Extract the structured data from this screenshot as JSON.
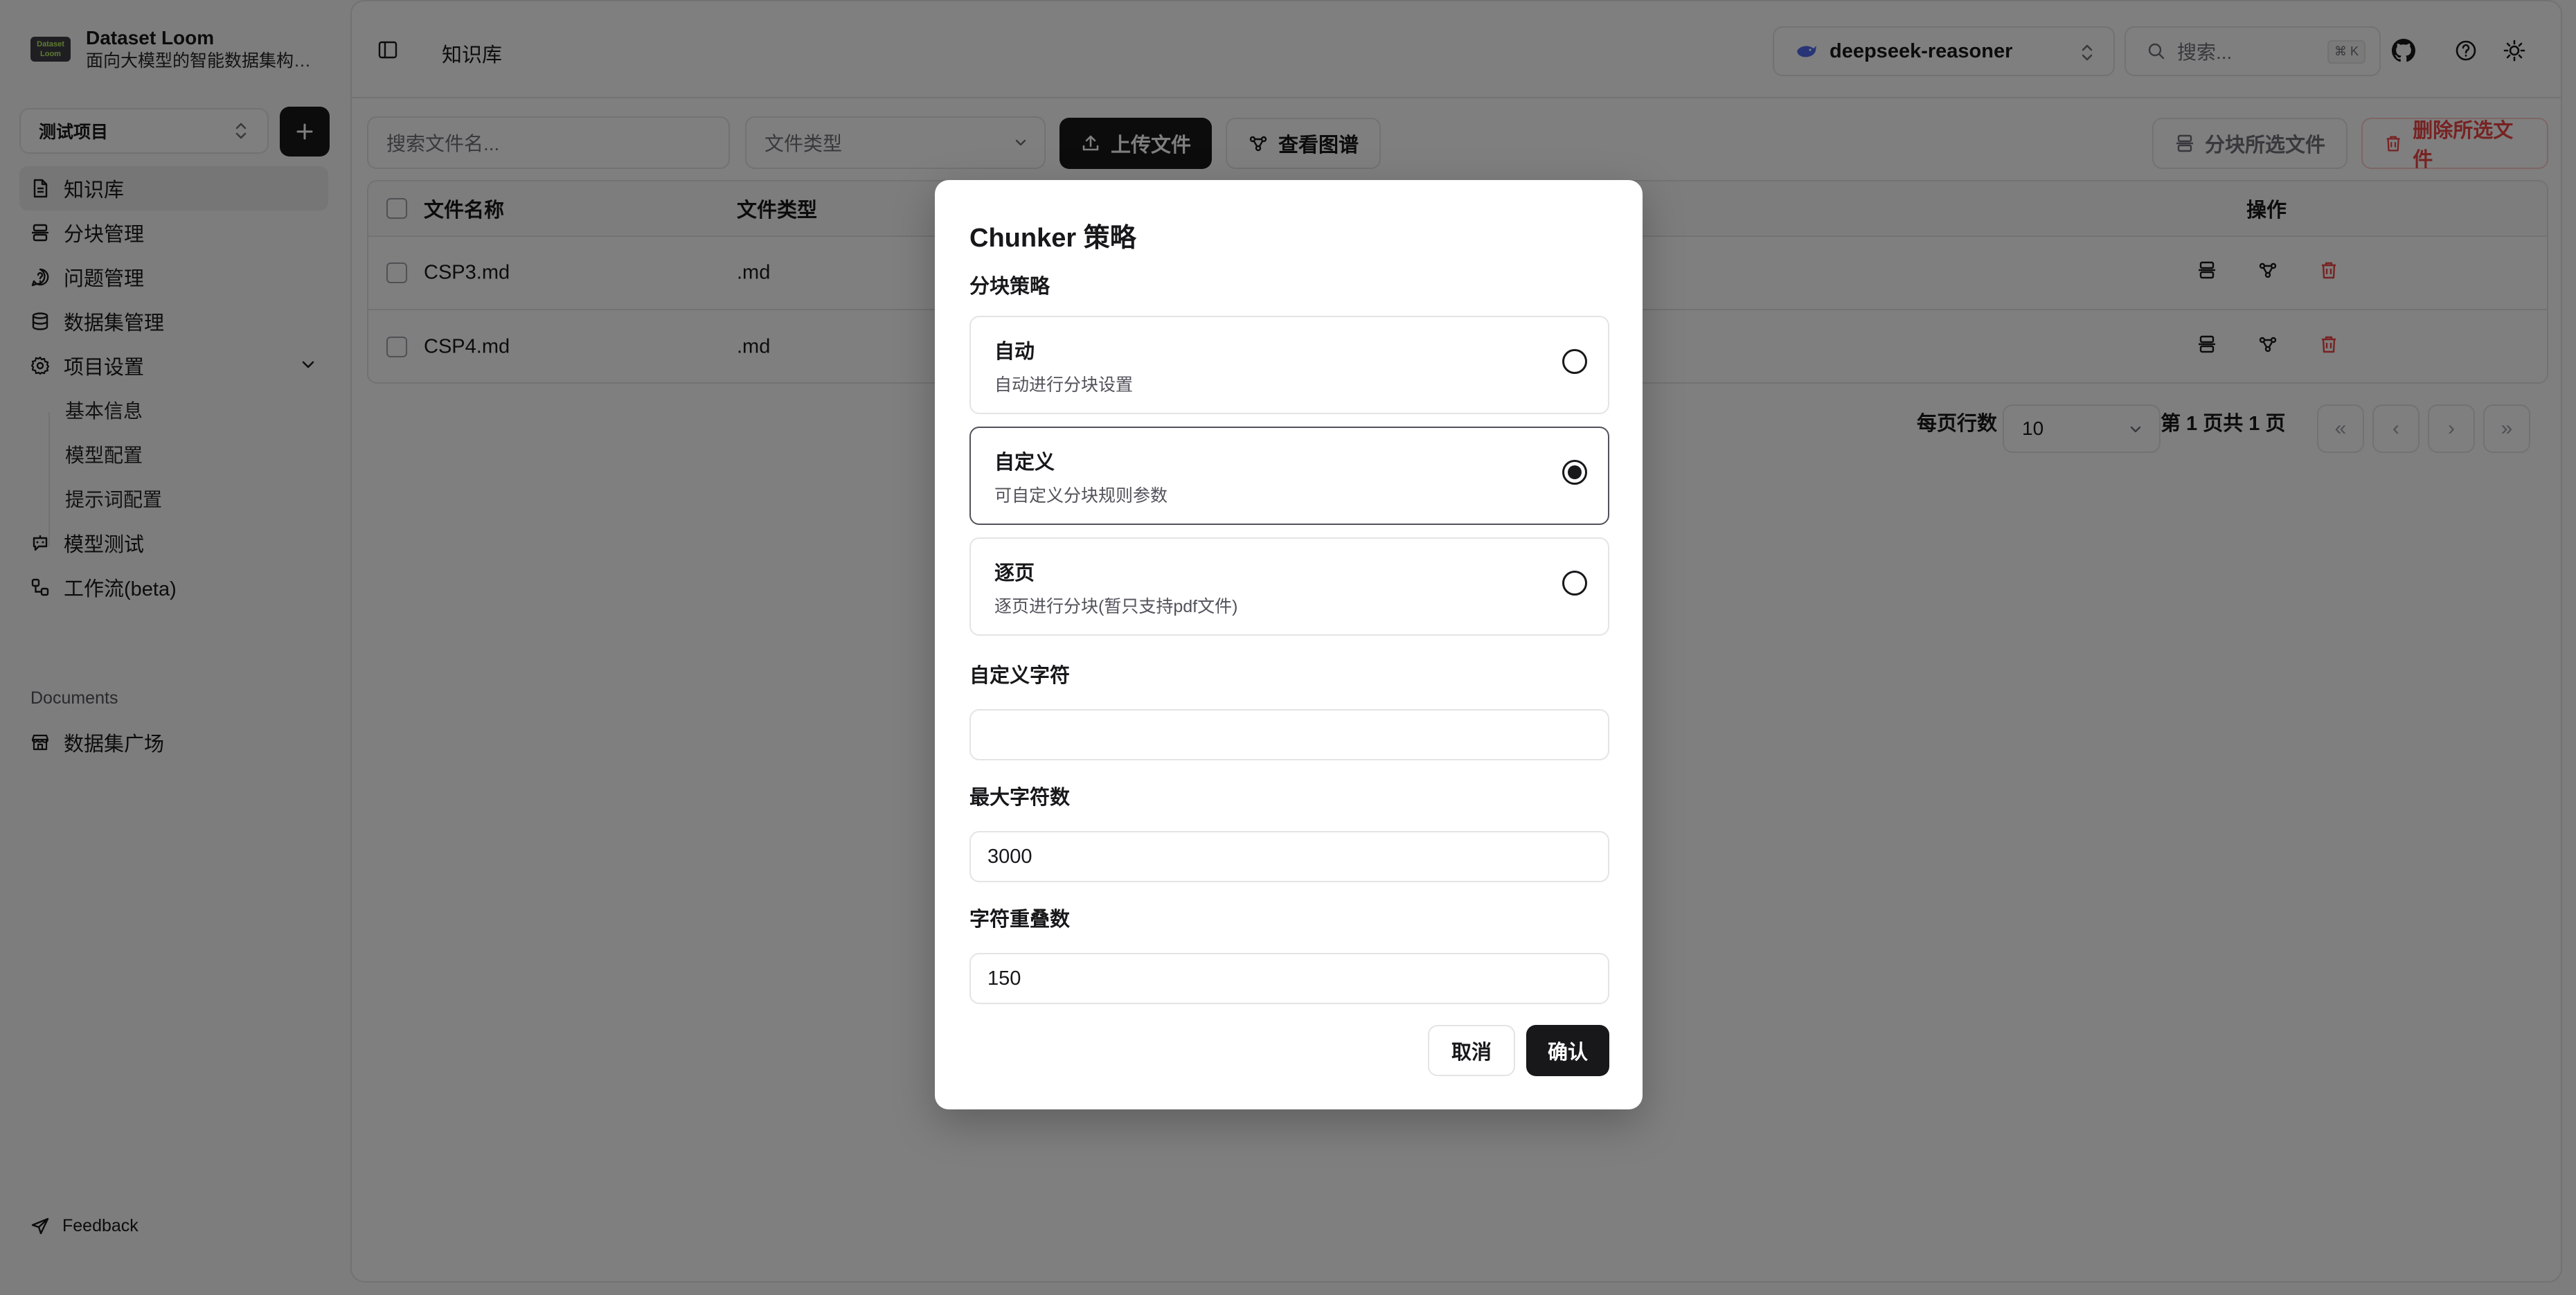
{
  "brand": {
    "name": "Dataset Loom",
    "subtitle": "面向大模型的智能数据集构建...",
    "logo_text_1": "Dataset",
    "logo_text_2": "Loom"
  },
  "project": {
    "selected": "测试项目"
  },
  "nav": {
    "items": [
      {
        "label": "知识库",
        "icon": "file-text-icon",
        "active": true
      },
      {
        "label": "分块管理",
        "icon": "split-icon"
      },
      {
        "label": "问题管理",
        "icon": "message-question-icon"
      },
      {
        "label": "数据集管理",
        "icon": "database-icon"
      },
      {
        "label": "项目设置",
        "icon": "gear-icon"
      }
    ],
    "settings_sub": [
      "基本信息",
      "模型配置",
      "提示词配置"
    ],
    "items_after": [
      {
        "label": "模型测试",
        "icon": "bot-icon"
      },
      {
        "label": "工作流(beta)",
        "icon": "workflow-icon"
      }
    ],
    "documents_label": "Documents",
    "documents_items": [
      {
        "label": "数据集广场",
        "icon": "store-icon"
      }
    ],
    "feedback": "Feedback"
  },
  "topbar": {
    "title": "知识库",
    "model": "deepseek-reasoner",
    "search_placeholder": "搜索...",
    "search_shortcut": "⌘ K"
  },
  "toolbar": {
    "filename_placeholder": "搜索文件名...",
    "filetype_placeholder": "文件类型",
    "upload_label": "上传文件",
    "graph_label": "查看图谱",
    "chunk_selected_label": "分块所选文件",
    "delete_selected_label": "删除所选文件"
  },
  "table": {
    "headers": {
      "name": "文件名称",
      "type": "文件类型",
      "actions": "操作"
    },
    "rows": [
      {
        "name": "CSP3.md",
        "type": ".md"
      },
      {
        "name": "CSP4.md",
        "type": ".md"
      }
    ]
  },
  "pagination": {
    "rows_label": "每页行数",
    "rows_value": "10",
    "page_info": "第 1 页共 1 页"
  },
  "dialog": {
    "title": "Chunker 策略",
    "strategy_label": "分块策略",
    "options": [
      {
        "title": "自动",
        "desc": "自动进行分块设置",
        "selected": false
      },
      {
        "title": "自定义",
        "desc": "可自定义分块规则参数",
        "selected": true
      },
      {
        "title": "逐页",
        "desc": "逐页进行分块(暂只支持pdf文件)",
        "selected": false
      }
    ],
    "custom_chars_label": "自定义字符",
    "custom_chars_value": "",
    "max_chars_label": "最大字符数",
    "max_chars_value": "3000",
    "overlap_label": "字符重叠数",
    "overlap_value": "150",
    "cancel_label": "取消",
    "confirm_label": "确认"
  },
  "colors": {
    "primary": "#18181b",
    "danger": "#ef4444",
    "border": "#e4e4e7",
    "overlay": "rgba(0,0,0,0.5)"
  }
}
